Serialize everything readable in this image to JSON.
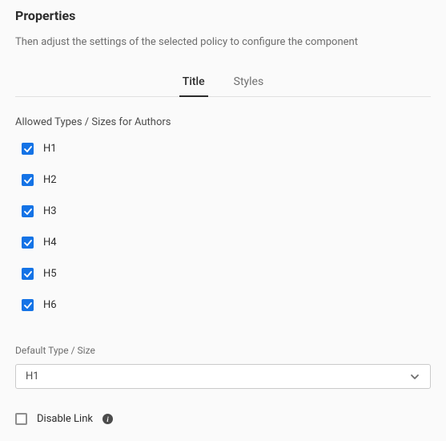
{
  "panel": {
    "title": "Properties",
    "description": "Then adjust the settings of the selected policy to configure the component"
  },
  "tabs": [
    {
      "label": "Title",
      "active": true
    },
    {
      "label": "Styles",
      "active": false
    }
  ],
  "allowed": {
    "section_label": "Allowed Types / Sizes for Authors",
    "items": [
      {
        "label": "H1",
        "checked": true
      },
      {
        "label": "H2",
        "checked": true
      },
      {
        "label": "H3",
        "checked": true
      },
      {
        "label": "H4",
        "checked": true
      },
      {
        "label": "H5",
        "checked": true
      },
      {
        "label": "H6",
        "checked": true
      }
    ]
  },
  "default_type": {
    "label": "Default Type / Size",
    "value": "H1"
  },
  "disable_link": {
    "label": "Disable Link",
    "checked": false
  }
}
